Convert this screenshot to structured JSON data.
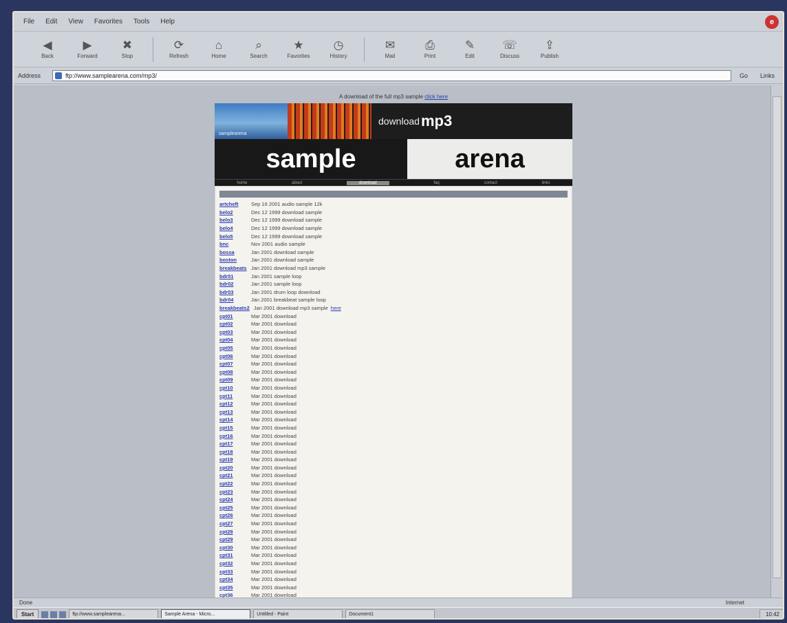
{
  "menubar": {
    "items": [
      "File",
      "Edit",
      "View",
      "Favorites",
      "Tools",
      "Help"
    ]
  },
  "toolbar": {
    "buttons": [
      {
        "label": "Back",
        "icon": "back-arrow-icon",
        "glyph": "◀"
      },
      {
        "label": "Forward",
        "icon": "forward-arrow-icon",
        "glyph": "▶"
      },
      {
        "label": "Stop",
        "icon": "stop-icon",
        "glyph": "✖"
      },
      {
        "label": "Refresh",
        "icon": "refresh-icon",
        "glyph": "⟳"
      },
      {
        "label": "Home",
        "icon": "home-icon",
        "glyph": "⌂"
      },
      {
        "label": "Search",
        "icon": "search-icon",
        "glyph": "⌕"
      },
      {
        "label": "Favorites",
        "icon": "favorites-icon",
        "glyph": "★"
      },
      {
        "label": "History",
        "icon": "history-icon",
        "glyph": "◷"
      },
      {
        "label": "Mail",
        "icon": "mail-icon",
        "glyph": "✉"
      },
      {
        "label": "Print",
        "icon": "print-icon",
        "glyph": "⎙"
      },
      {
        "label": "Edit",
        "icon": "edit-icon",
        "glyph": "✎"
      },
      {
        "label": "Discuss",
        "icon": "discuss-icon",
        "glyph": "☏"
      },
      {
        "label": "Publish",
        "icon": "publish-icon",
        "glyph": "⇪"
      }
    ]
  },
  "address": {
    "label": "Address",
    "url": "ftp://www.samplearena.com/mp3/",
    "go": "Go",
    "links": "Links"
  },
  "page": {
    "top_note": "A download of the full mp3 sample",
    "top_note_link": "click here",
    "brand_tag": "samplearena",
    "download_text": "download",
    "download_bold": "mp3",
    "title_left": "sample",
    "title_right": "arena",
    "nav": [
      "home",
      "about",
      "download",
      "faq",
      "contact",
      "links"
    ],
    "nav_active": 2,
    "rows": [
      {
        "name": "artcheft",
        "info": "Sep 16 2001  audio sample  12k"
      },
      {
        "name": "belo2",
        "info": "Dec 12 1999  download sample"
      },
      {
        "name": "belo3",
        "info": "Dec 12 1999  download sample"
      },
      {
        "name": "belo4",
        "info": "Dec 12 1999  download sample"
      },
      {
        "name": "belo5",
        "info": "Dec 12 1999  download sample"
      },
      {
        "name": "bnc",
        "info": "Nov 2001  audio sample"
      },
      {
        "name": "bossa",
        "info": "Jan 2001  download sample"
      },
      {
        "name": "boston",
        "info": "Jan 2001  download sample"
      },
      {
        "name": "breakbeats",
        "info": "Jan 2001  download mp3 sample"
      },
      {
        "name": "bdr01",
        "info": "Jan 2001  sample loop"
      },
      {
        "name": "bdr02",
        "info": "Jan 2001  sample loop"
      },
      {
        "name": "bdr03",
        "info": "Jan 2001  drum loop download"
      },
      {
        "name": "bdr04",
        "info": "Jan 2001  breakbeat sample loop"
      },
      {
        "name": "breakbeats2",
        "info": "Jan 2001  download mp3 sample",
        "extra": "here"
      },
      {
        "name": "cpt01",
        "info": "Mar 2001  download"
      },
      {
        "name": "cpt02",
        "info": "Mar 2001  download"
      },
      {
        "name": "cpt03",
        "info": "Mar 2001  download"
      },
      {
        "name": "cpt04",
        "info": "Mar 2001  download"
      },
      {
        "name": "cpt05",
        "info": "Mar 2001  download"
      },
      {
        "name": "cpt06",
        "info": "Mar 2001  download"
      },
      {
        "name": "cpt07",
        "info": "Mar 2001  download"
      },
      {
        "name": "cpt08",
        "info": "Mar 2001  download"
      },
      {
        "name": "cpt09",
        "info": "Mar 2001  download"
      },
      {
        "name": "cpt10",
        "info": "Mar 2001  download"
      },
      {
        "name": "cpt11",
        "info": "Mar 2001  download"
      },
      {
        "name": "cpt12",
        "info": "Mar 2001  download"
      },
      {
        "name": "cpt13",
        "info": "Mar 2001  download"
      },
      {
        "name": "cpt14",
        "info": "Mar 2001  download"
      },
      {
        "name": "cpt15",
        "info": "Mar 2001  download"
      },
      {
        "name": "cpt16",
        "info": "Mar 2001  download"
      },
      {
        "name": "cpt17",
        "info": "Mar 2001  download"
      },
      {
        "name": "cpt18",
        "info": "Mar 2001  download"
      },
      {
        "name": "cpt19",
        "info": "Mar 2001  download"
      },
      {
        "name": "cpt20",
        "info": "Mar 2001  download"
      },
      {
        "name": "cpt21",
        "info": "Mar 2001  download"
      },
      {
        "name": "cpt22",
        "info": "Mar 2001  download"
      },
      {
        "name": "cpt23",
        "info": "Mar 2001  download"
      },
      {
        "name": "cpt24",
        "info": "Mar 2001  download"
      },
      {
        "name": "cpt25",
        "info": "Mar 2001  download"
      },
      {
        "name": "cpt26",
        "info": "Mar 2001  download"
      },
      {
        "name": "cpt27",
        "info": "Mar 2001  download"
      },
      {
        "name": "cpt28",
        "info": "Mar 2001  download"
      },
      {
        "name": "cpt29",
        "info": "Mar 2001  download"
      },
      {
        "name": "cpt30",
        "info": "Mar 2001  download"
      },
      {
        "name": "cpt31",
        "info": "Mar 2001  download"
      },
      {
        "name": "cpt32",
        "info": "Mar 2001  download"
      },
      {
        "name": "cpt33",
        "info": "Mar 2001  download"
      },
      {
        "name": "cpt34",
        "info": "Mar 2001  download"
      },
      {
        "name": "cpt35",
        "info": "Mar 2001  download"
      },
      {
        "name": "cpt36",
        "info": "Mar 2001  download"
      }
    ]
  },
  "statusbar": {
    "text": "Done",
    "zone": "Internet"
  },
  "taskbar": {
    "start": "Start",
    "tasks": [
      "ftp://www.samplearena...",
      "Sample Arena - Micro...",
      "Untitled - Paint",
      "Document1"
    ],
    "active_task": 1,
    "clock": "10:42"
  }
}
